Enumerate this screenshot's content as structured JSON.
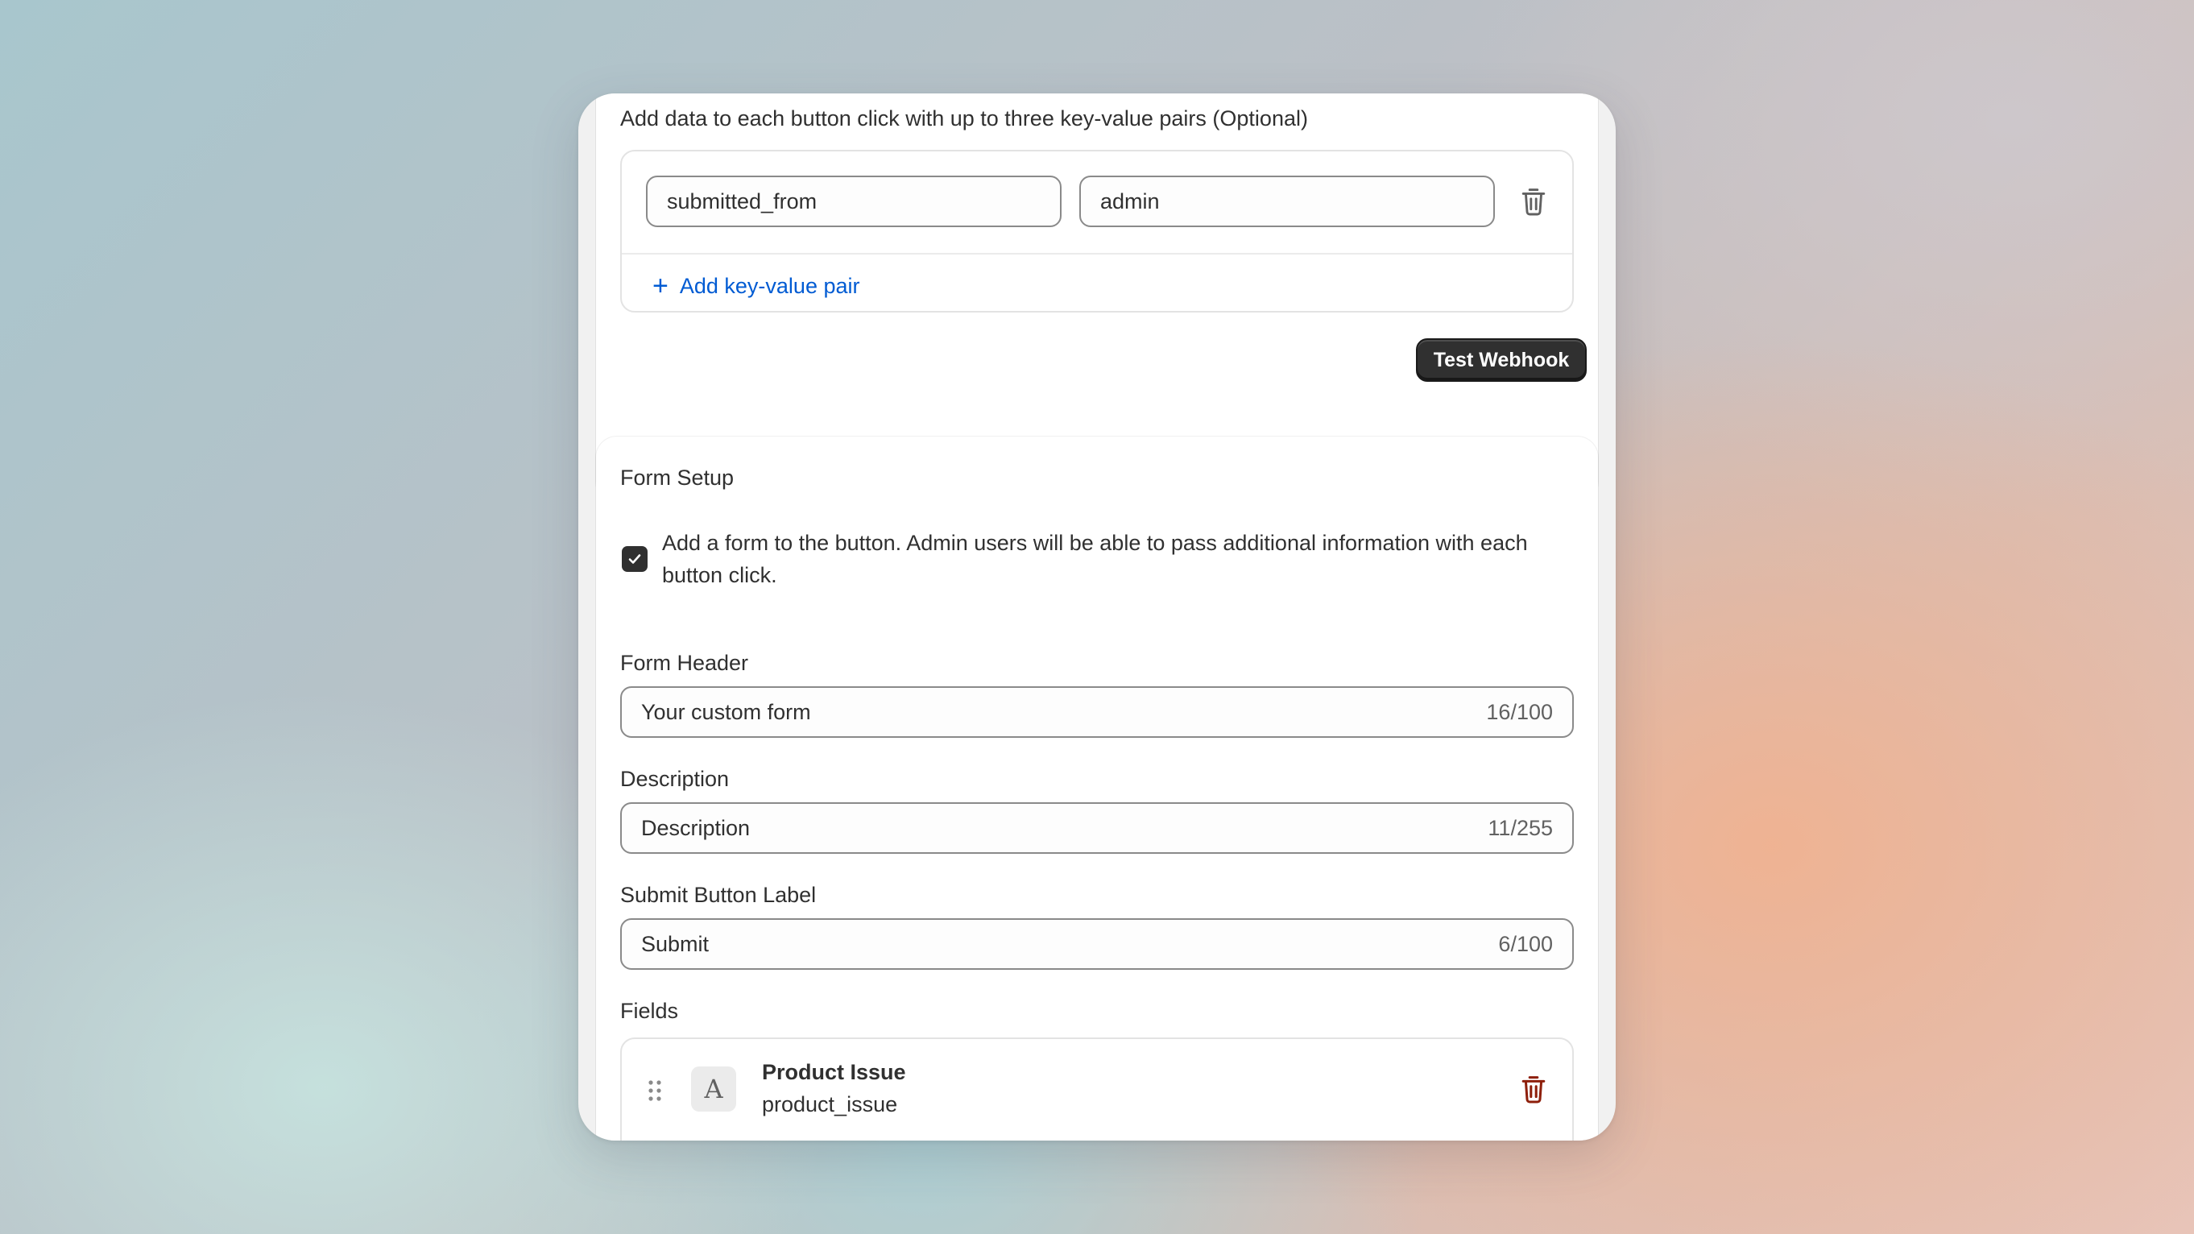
{
  "webhook": {
    "kv_title": "Add data to each button click with up to three key-value pairs (Optional)",
    "pairs": [
      {
        "key": "submitted_from",
        "value": "admin"
      }
    ],
    "add_pair_label": "Add key-value pair",
    "test_button_label": "Test Webhook"
  },
  "form_setup": {
    "title": "Form Setup",
    "checkbox_checked": true,
    "checkbox_label": "Add a form to the button. Admin users will be able to pass additional information with each button click.",
    "form_header": {
      "label": "Form Header",
      "value": "Your custom form",
      "count": "16/100"
    },
    "description": {
      "label": "Description",
      "value": "Description",
      "count": "11/255"
    },
    "submit_label": {
      "label": "Submit Button Label",
      "value": "Submit",
      "count": "6/100"
    },
    "fields_label": "Fields",
    "fields": [
      {
        "type_icon": "text-type-icon",
        "type_glyph": "A",
        "name": "Product Issue",
        "key": "product_issue"
      }
    ]
  },
  "colors": {
    "link": "#005bd3",
    "primary_button": "#303030",
    "danger_icon": "#8e1f0b",
    "muted_icon": "#616161"
  }
}
